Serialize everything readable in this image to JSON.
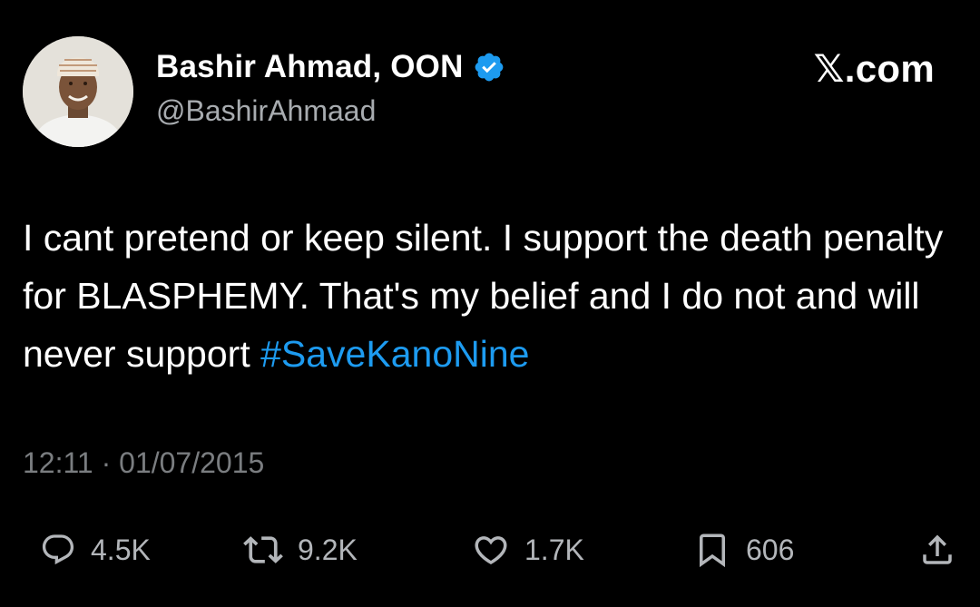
{
  "author": {
    "display_name": "Bashir Ahmad, OON",
    "handle": "@BashirAhmaad",
    "verified": true,
    "avatar": "profile-photo"
  },
  "brand": {
    "text": "𝕏.com"
  },
  "tweet": {
    "text_before": "I cant pretend or keep silent. I support the death penalty for BLASPHEMY. That's my belief and I do not and will never support ",
    "hashtag": "#SaveKanoNine",
    "timestamp": "12:11 · 01/07/2015"
  },
  "actions": {
    "reply": {
      "icon": "reply-icon",
      "count": "4.5K"
    },
    "retweet": {
      "icon": "retweet-icon",
      "count": "9.2K"
    },
    "like": {
      "icon": "heart-icon",
      "count": "1.7K"
    },
    "bookmark": {
      "icon": "bookmark-icon",
      "count": "606"
    },
    "share": {
      "icon": "share-icon"
    }
  },
  "colors": {
    "background": "#000000",
    "text": "#ffffff",
    "secondary": "#a8acb0",
    "link": "#1d9bf0",
    "verified": "#1d9bf0"
  }
}
